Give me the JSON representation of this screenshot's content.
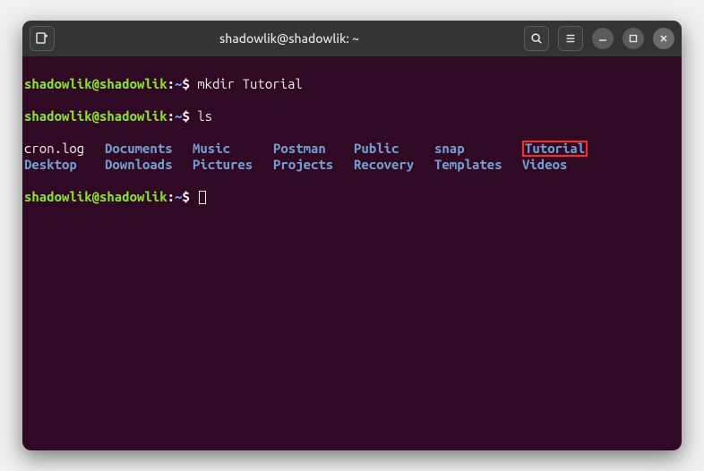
{
  "titlebar": {
    "title": "shadowlik@shadowlik: ~"
  },
  "prompt": {
    "user_host": "shadowlik@shadowlik",
    "separator": ":",
    "path": "~",
    "symbol": "$"
  },
  "commands": {
    "cmd1": "mkdir Tutorial",
    "cmd2": "ls"
  },
  "ls": {
    "row1": {
      "c1": "cron.log",
      "c2": "Documents",
      "c3": "Music",
      "c4": "Postman",
      "c5": "Public",
      "c6": "snap",
      "c7": "Tutorial"
    },
    "row2": {
      "c1": "Desktop",
      "c2": "Downloads",
      "c3": "Pictures",
      "c4": "Projects",
      "c5": "Recovery",
      "c6": "Templates",
      "c7": "Videos"
    }
  }
}
